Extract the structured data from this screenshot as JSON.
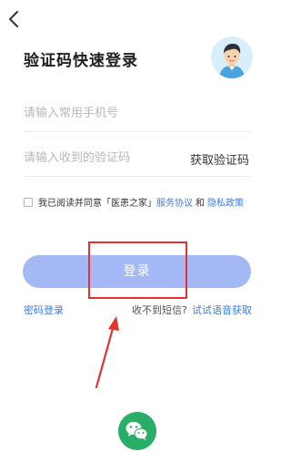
{
  "header": {
    "back_icon": "chevron-left-icon",
    "title": "验证码快速登录",
    "avatar_icon": "user-avatar-icon"
  },
  "form": {
    "phone_placeholder": "请输入常用手机号",
    "phone_value": "",
    "code_placeholder": "请输入收到的验证码",
    "code_value": "",
    "get_code_label": "获取验证码"
  },
  "agreement": {
    "checked": false,
    "prefix": "我已阅读并同意「医患之家」",
    "service_link": "服务协议",
    "and_text": "和",
    "privacy_link": "隐私政策"
  },
  "login_button_label": "登录",
  "footer_links": {
    "password_login": "密码登录",
    "no_sms": "收不到短信?",
    "voice_code": "试试语音获取"
  },
  "social": {
    "wechat_icon": "wechat-icon"
  },
  "colors": {
    "accent_blue": "#3e7be6",
    "login_button_bg": "#a5b8f6",
    "highlight_red": "#e5322d",
    "wechat_green": "#2aae67"
  }
}
